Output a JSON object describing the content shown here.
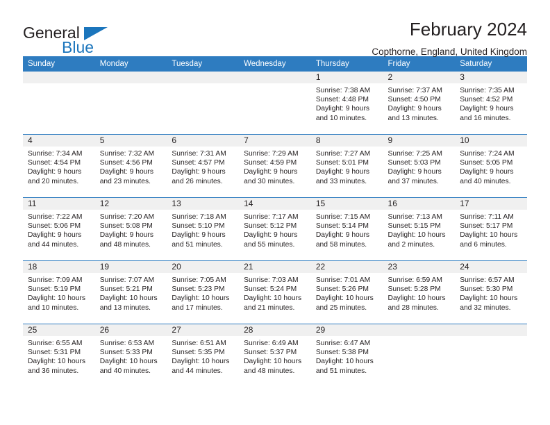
{
  "brand": {
    "name_top": "General",
    "name_bottom": "Blue",
    "accent_color": "#1b75bc",
    "text_color": "#231f20"
  },
  "header": {
    "title": "February 2024",
    "subtitle": "Copthorne, England, United Kingdom"
  },
  "calendar": {
    "header_bg": "#2e7cc0",
    "daynum_bg": "#f0f0f0",
    "weekday_headers": [
      "Sunday",
      "Monday",
      "Tuesday",
      "Wednesday",
      "Thursday",
      "Friday",
      "Saturday"
    ],
    "weeks": [
      [
        {
          "day": "",
          "lines": []
        },
        {
          "day": "",
          "lines": []
        },
        {
          "day": "",
          "lines": []
        },
        {
          "day": "",
          "lines": []
        },
        {
          "day": "1",
          "lines": [
            "Sunrise: 7:38 AM",
            "Sunset: 4:48 PM",
            "Daylight: 9 hours",
            "and 10 minutes."
          ]
        },
        {
          "day": "2",
          "lines": [
            "Sunrise: 7:37 AM",
            "Sunset: 4:50 PM",
            "Daylight: 9 hours",
            "and 13 minutes."
          ]
        },
        {
          "day": "3",
          "lines": [
            "Sunrise: 7:35 AM",
            "Sunset: 4:52 PM",
            "Daylight: 9 hours",
            "and 16 minutes."
          ]
        }
      ],
      [
        {
          "day": "4",
          "lines": [
            "Sunrise: 7:34 AM",
            "Sunset: 4:54 PM",
            "Daylight: 9 hours",
            "and 20 minutes."
          ]
        },
        {
          "day": "5",
          "lines": [
            "Sunrise: 7:32 AM",
            "Sunset: 4:56 PM",
            "Daylight: 9 hours",
            "and 23 minutes."
          ]
        },
        {
          "day": "6",
          "lines": [
            "Sunrise: 7:31 AM",
            "Sunset: 4:57 PM",
            "Daylight: 9 hours",
            "and 26 minutes."
          ]
        },
        {
          "day": "7",
          "lines": [
            "Sunrise: 7:29 AM",
            "Sunset: 4:59 PM",
            "Daylight: 9 hours",
            "and 30 minutes."
          ]
        },
        {
          "day": "8",
          "lines": [
            "Sunrise: 7:27 AM",
            "Sunset: 5:01 PM",
            "Daylight: 9 hours",
            "and 33 minutes."
          ]
        },
        {
          "day": "9",
          "lines": [
            "Sunrise: 7:25 AM",
            "Sunset: 5:03 PM",
            "Daylight: 9 hours",
            "and 37 minutes."
          ]
        },
        {
          "day": "10",
          "lines": [
            "Sunrise: 7:24 AM",
            "Sunset: 5:05 PM",
            "Daylight: 9 hours",
            "and 40 minutes."
          ]
        }
      ],
      [
        {
          "day": "11",
          "lines": [
            "Sunrise: 7:22 AM",
            "Sunset: 5:06 PM",
            "Daylight: 9 hours",
            "and 44 minutes."
          ]
        },
        {
          "day": "12",
          "lines": [
            "Sunrise: 7:20 AM",
            "Sunset: 5:08 PM",
            "Daylight: 9 hours",
            "and 48 minutes."
          ]
        },
        {
          "day": "13",
          "lines": [
            "Sunrise: 7:18 AM",
            "Sunset: 5:10 PM",
            "Daylight: 9 hours",
            "and 51 minutes."
          ]
        },
        {
          "day": "14",
          "lines": [
            "Sunrise: 7:17 AM",
            "Sunset: 5:12 PM",
            "Daylight: 9 hours",
            "and 55 minutes."
          ]
        },
        {
          "day": "15",
          "lines": [
            "Sunrise: 7:15 AM",
            "Sunset: 5:14 PM",
            "Daylight: 9 hours",
            "and 58 minutes."
          ]
        },
        {
          "day": "16",
          "lines": [
            "Sunrise: 7:13 AM",
            "Sunset: 5:15 PM",
            "Daylight: 10 hours",
            "and 2 minutes."
          ]
        },
        {
          "day": "17",
          "lines": [
            "Sunrise: 7:11 AM",
            "Sunset: 5:17 PM",
            "Daylight: 10 hours",
            "and 6 minutes."
          ]
        }
      ],
      [
        {
          "day": "18",
          "lines": [
            "Sunrise: 7:09 AM",
            "Sunset: 5:19 PM",
            "Daylight: 10 hours",
            "and 10 minutes."
          ]
        },
        {
          "day": "19",
          "lines": [
            "Sunrise: 7:07 AM",
            "Sunset: 5:21 PM",
            "Daylight: 10 hours",
            "and 13 minutes."
          ]
        },
        {
          "day": "20",
          "lines": [
            "Sunrise: 7:05 AM",
            "Sunset: 5:23 PM",
            "Daylight: 10 hours",
            "and 17 minutes."
          ]
        },
        {
          "day": "21",
          "lines": [
            "Sunrise: 7:03 AM",
            "Sunset: 5:24 PM",
            "Daylight: 10 hours",
            "and 21 minutes."
          ]
        },
        {
          "day": "22",
          "lines": [
            "Sunrise: 7:01 AM",
            "Sunset: 5:26 PM",
            "Daylight: 10 hours",
            "and 25 minutes."
          ]
        },
        {
          "day": "23",
          "lines": [
            "Sunrise: 6:59 AM",
            "Sunset: 5:28 PM",
            "Daylight: 10 hours",
            "and 28 minutes."
          ]
        },
        {
          "day": "24",
          "lines": [
            "Sunrise: 6:57 AM",
            "Sunset: 5:30 PM",
            "Daylight: 10 hours",
            "and 32 minutes."
          ]
        }
      ],
      [
        {
          "day": "25",
          "lines": [
            "Sunrise: 6:55 AM",
            "Sunset: 5:31 PM",
            "Daylight: 10 hours",
            "and 36 minutes."
          ]
        },
        {
          "day": "26",
          "lines": [
            "Sunrise: 6:53 AM",
            "Sunset: 5:33 PM",
            "Daylight: 10 hours",
            "and 40 minutes."
          ]
        },
        {
          "day": "27",
          "lines": [
            "Sunrise: 6:51 AM",
            "Sunset: 5:35 PM",
            "Daylight: 10 hours",
            "and 44 minutes."
          ]
        },
        {
          "day": "28",
          "lines": [
            "Sunrise: 6:49 AM",
            "Sunset: 5:37 PM",
            "Daylight: 10 hours",
            "and 48 minutes."
          ]
        },
        {
          "day": "29",
          "lines": [
            "Sunrise: 6:47 AM",
            "Sunset: 5:38 PM",
            "Daylight: 10 hours",
            "and 51 minutes."
          ]
        },
        {
          "day": "",
          "lines": []
        },
        {
          "day": "",
          "lines": []
        }
      ]
    ]
  }
}
